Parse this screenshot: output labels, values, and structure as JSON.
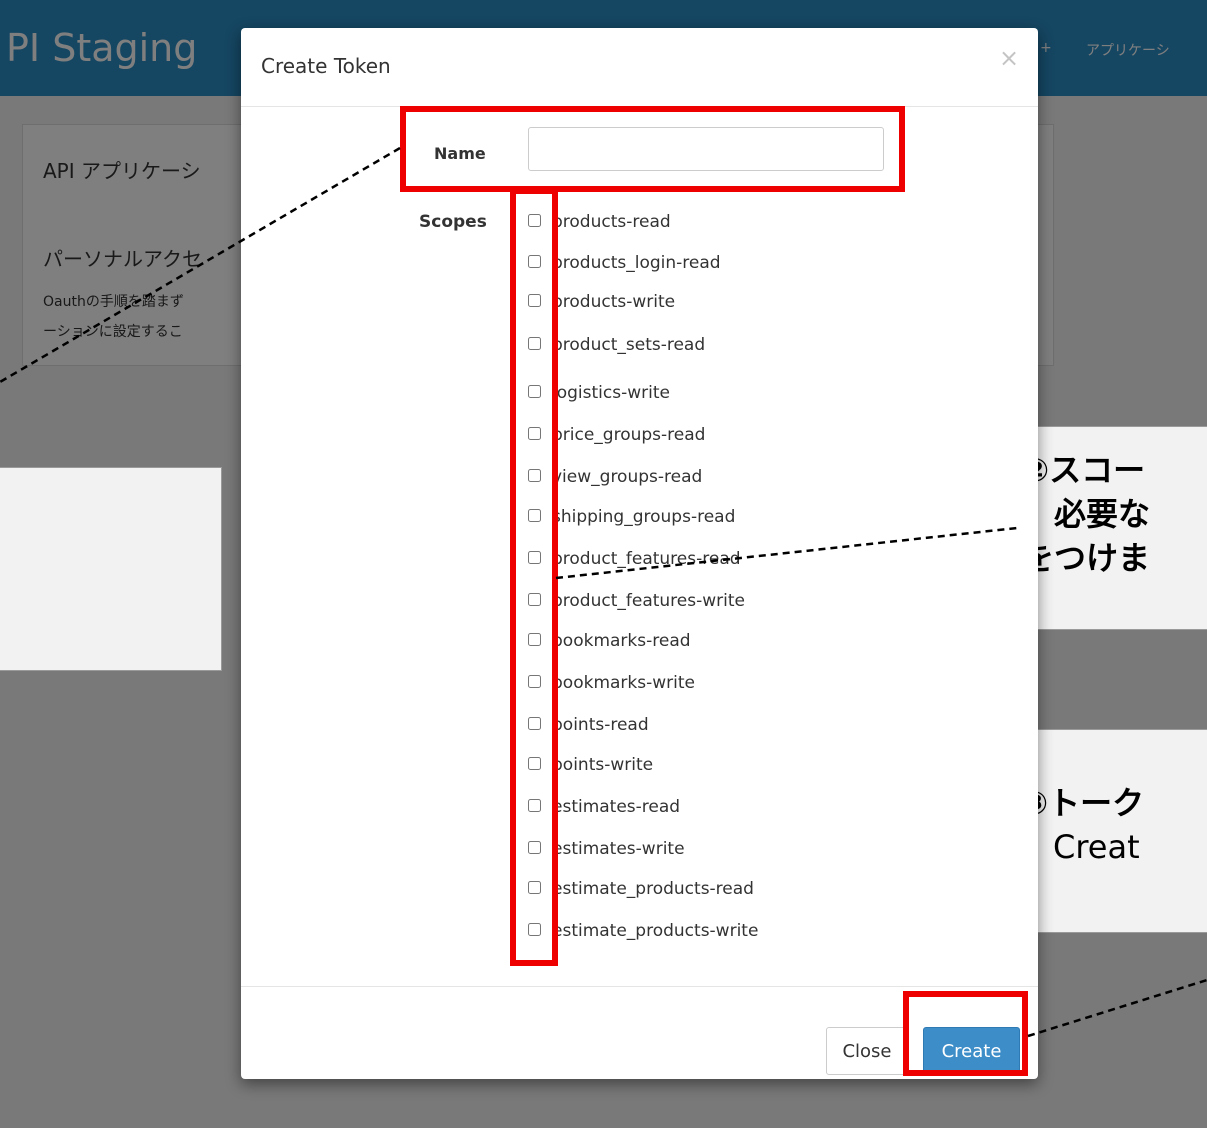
{
  "app": {
    "brand": "PI Staging",
    "nav_right": "アプリケーシ",
    "nav_small": "+",
    "panel_title": "API アプリケーシ",
    "panel_subtitle": "パーソナルアクセ",
    "panel_desc_1": "Oauthの手順を踏まず",
    "panel_desc_2": "ーションに設定するこ"
  },
  "modal": {
    "title": "Create Token",
    "close_symbol": "×",
    "name_label": "Name",
    "name_value": "",
    "scopes_label": "Scopes",
    "scopes": [
      "products-read",
      "products_login-read",
      "products-write",
      "product_sets-read",
      "logistics-write",
      "price_groups-read",
      "view_groups-read",
      "shipping_groups-read",
      "product_features-read",
      "product_features-write",
      "bookmarks-read",
      "bookmarks-write",
      "points-read",
      "points-write",
      "estimates-read",
      "estimates-write",
      "estimate_products-read",
      "estimate_products-write"
    ],
    "close_button": "Close",
    "create_button": "Create"
  },
  "annotations": {
    "scope_line1": "②スコー",
    "scope_line2": "　必要な",
    "scope_line3": "をつけま",
    "create_line1": "③トーク",
    "create_line2": "　Creat"
  },
  "colors": {
    "topbar": "#2b8cc4",
    "highlight": "#ee0000",
    "primary_button": "#3c8dc8"
  }
}
